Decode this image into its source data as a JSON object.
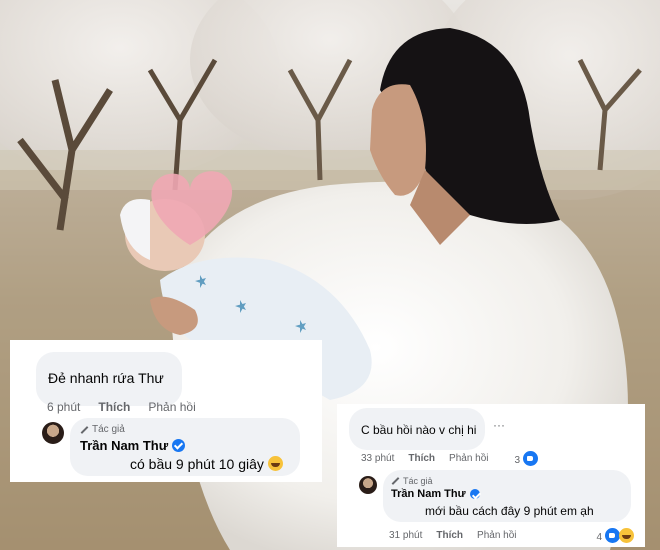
{
  "comment_left": {
    "text": "Đẻ nhanh rứa Thư",
    "time": "6 phút",
    "like": "Thích",
    "reply": "Phản hồi",
    "author_badge": "Tác giả",
    "author_name": "Trần Nam Thư",
    "author_reply": "có bầu 9 phút 10 giây"
  },
  "comment_right": {
    "text": "C bầu hồi nào v chị hi",
    "more": "···",
    "time": "33 phút",
    "like": "Thích",
    "reply": "Phản hồi",
    "reaction_count": "3",
    "author_badge": "Tác giả",
    "author_name": "Trần Nam Thư",
    "author_reply": "mới bầu cách đây 9 phút em ạh",
    "reply_time": "31 phút",
    "reply_like": "Thích",
    "reply_reply": "Phản hồi",
    "reply_reaction_count": "4"
  },
  "icons": {
    "verified": "verified-badge-icon",
    "pencil": "pencil-icon",
    "like": "like-reaction-icon",
    "haha": "haha-reaction-icon"
  },
  "colors": {
    "link_blue": "#1877f2",
    "muted": "#65676b",
    "bubble": "#f0f2f5"
  }
}
